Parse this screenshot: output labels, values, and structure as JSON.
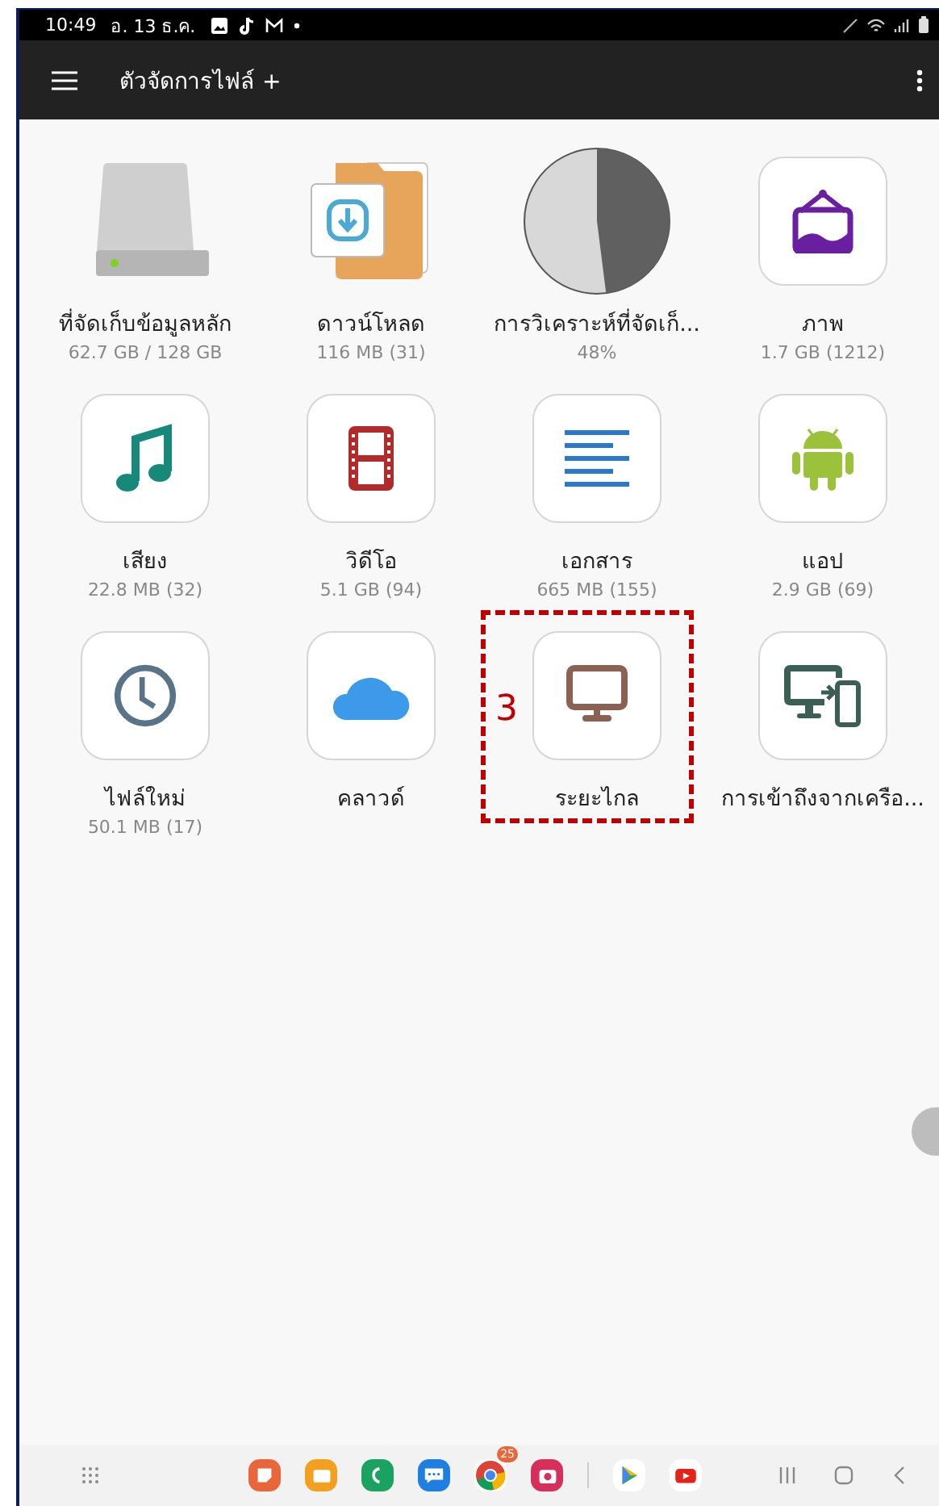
{
  "status_bar": {
    "time": "10:49",
    "date": "อ. 13 ธ.ค."
  },
  "app_bar": {
    "title": "ตัวจัดการไฟล์ +"
  },
  "categories": [
    {
      "kind": "drive",
      "label": "ที่จัดเก็บข้อมูลหลัก",
      "detail": "62.7 GB / 128 GB"
    },
    {
      "kind": "downloads",
      "label": "ดาวน์โหลด",
      "detail": "116 MB (31)"
    },
    {
      "kind": "analysis",
      "label": "การวิเคราะห์ที่จัดเก็...",
      "detail": "48%",
      "level": 0.48
    },
    {
      "kind": "images",
      "label": "ภาพ",
      "detail": "1.7 GB (1212)"
    },
    {
      "kind": "audio",
      "label": "เสียง",
      "detail": "22.8 MB (32)"
    },
    {
      "kind": "video",
      "label": "วิดีโอ",
      "detail": "5.1 GB (94)"
    },
    {
      "kind": "documents",
      "label": "เอกสาร",
      "detail": "665 MB (155)"
    },
    {
      "kind": "apps",
      "label": "แอป",
      "detail": "2.9 GB (69)"
    },
    {
      "kind": "recent",
      "label": "ไฟล์ใหม่",
      "detail": "50.1 MB (17)"
    },
    {
      "kind": "cloud",
      "label": "คลาวด์"
    },
    {
      "kind": "remote",
      "label": "ระยะไกล",
      "annotation": "3"
    },
    {
      "kind": "network",
      "label": "การเข้าถึงจากเครือ..."
    }
  ],
  "dock": [
    {
      "kind": "notes",
      "color": "#e8663a"
    },
    {
      "kind": "folder",
      "color": "#f2a01e"
    },
    {
      "kind": "phone",
      "color": "#1aa260"
    },
    {
      "kind": "chat",
      "color": "#1e7fe0"
    },
    {
      "kind": "browser",
      "color": "#ffffff",
      "badge": "25"
    },
    {
      "kind": "camera",
      "color": "#d6305a"
    },
    {
      "kind": "divider"
    },
    {
      "kind": "store",
      "color": "#ffffff"
    },
    {
      "kind": "video",
      "color": "#ffffff"
    }
  ]
}
